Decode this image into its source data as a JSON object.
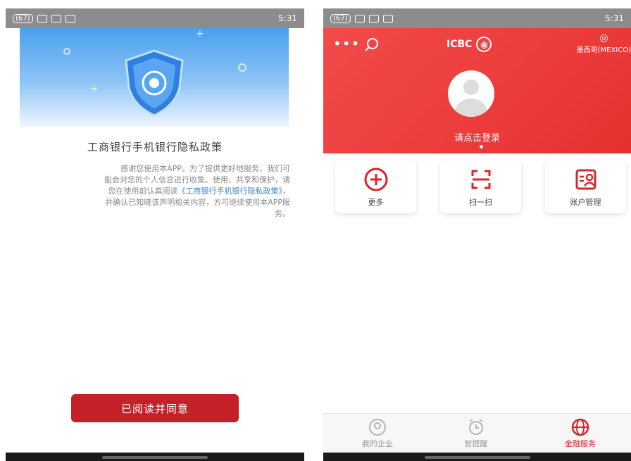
{
  "left_screen": {
    "status_time": "5:31",
    "status_battery": "(67)",
    "title": "工商银行手机银行隐私政策",
    "text": {
      "line1": "感谢您使用本APP。为了提供更好地服务，我们可",
      "line2": "能会对您的个人信息进行收集、使用、共享和保护，请",
      "line3_pre": "您在使用前认真阅读",
      "line3_link": "《工商银行手机银行隐私政策》",
      "line3_post": "，",
      "line4": "并确认已知晓该声明相关内容，方可继续使用本APP服",
      "line5": "务。"
    },
    "agree_button": "已阅读并同意"
  },
  "right_screen": {
    "status_time": "5:31",
    "status_battery": "(67)",
    "header": {
      "more": "•••",
      "logo_text": "ICBC",
      "logo_badge": "㊎",
      "region": "墨西哥(MEXICO)",
      "login": "请点击登录"
    },
    "quick_actions": [
      {
        "label": "更多",
        "icon": "plus-circle-icon"
      },
      {
        "label": "扫一扫",
        "icon": "scan-icon"
      },
      {
        "label": "账户管理",
        "icon": "account-manage-icon"
      }
    ],
    "tabs": [
      {
        "label": "我的企业",
        "icon": "user-circle-icon"
      },
      {
        "label": "智提醒",
        "icon": "alarm-icon"
      },
      {
        "label": "金融服务",
        "icon": "globe-icon"
      }
    ],
    "accent_color": "#d9262c"
  }
}
